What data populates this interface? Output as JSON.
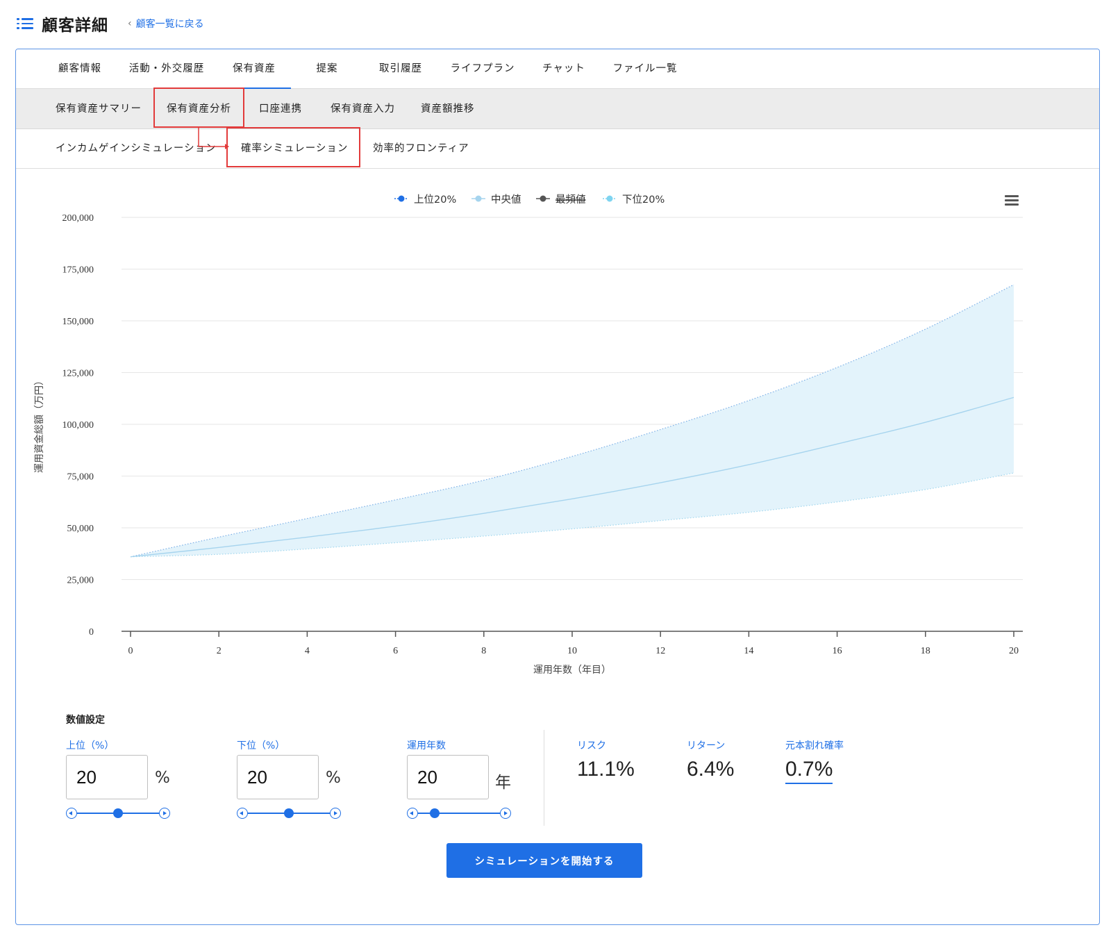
{
  "header": {
    "title": "顧客詳細",
    "back_link": "顧客一覧に戻る"
  },
  "tabs": [
    {
      "label": "顧客情報"
    },
    {
      "label": "活動・外交履歴"
    },
    {
      "label": "保有資産",
      "active": true
    },
    {
      "label": "提案"
    },
    {
      "label": "取引履歴"
    },
    {
      "label": "ライフプラン"
    },
    {
      "label": "チャット"
    },
    {
      "label": "ファイル一覧"
    }
  ],
  "subtabs": [
    {
      "label": "保有資産サマリー"
    },
    {
      "label": "保有資産分析",
      "highlighted": true
    },
    {
      "label": "口座連携"
    },
    {
      "label": "保有資産入力"
    },
    {
      "label": "資産額推移"
    }
  ],
  "subsubtabs": [
    {
      "label": "インカムゲインシミュレーション"
    },
    {
      "label": "確率シミュレーション",
      "highlighted": true
    },
    {
      "label": "効率的フロンティア"
    }
  ],
  "colors": {
    "accent": "#1f6fe5",
    "highlight_red": "#e23a3a",
    "band_fill": "#e3f3fb",
    "median_line": "#a6d4ee"
  },
  "chart_data": {
    "type": "area",
    "xlabel": "運用年数（年目）",
    "ylabel": "運用資金総額（万円）",
    "xlim": [
      0,
      20
    ],
    "ylim": [
      0,
      200000
    ],
    "x_ticks": [
      0,
      2,
      4,
      6,
      8,
      10,
      12,
      14,
      16,
      18,
      20
    ],
    "y_ticks": [
      0,
      25000,
      50000,
      75000,
      100000,
      125000,
      150000,
      175000,
      200000
    ],
    "y_tick_labels": [
      "0",
      "25,000",
      "50,000",
      "75,000",
      "100,000",
      "125,000",
      "150,000",
      "175,000",
      "200,000"
    ],
    "legend_position": "top-center",
    "x": [
      0,
      2,
      4,
      6,
      8,
      10,
      12,
      14,
      16,
      18,
      20
    ],
    "series": [
      {
        "name": "上位20%",
        "color": "#1f6fe5",
        "values": [
          36000,
          45500,
          54500,
          63500,
          73000,
          84500,
          97500,
          111500,
          127500,
          146000,
          167500
        ]
      },
      {
        "name": "中央値",
        "color": "#a6d4ee",
        "values": [
          36000,
          40500,
          45500,
          50800,
          57000,
          64000,
          71800,
          80500,
          90500,
          101000,
          113000
        ]
      },
      {
        "name": "最頻値",
        "color": "#555555",
        "values": []
      },
      {
        "name": "下位20%",
        "color": "#7fd4f0",
        "values": [
          36000,
          37200,
          39800,
          42800,
          46000,
          49500,
          53500,
          57500,
          62500,
          68500,
          76500
        ]
      }
    ]
  },
  "settings": {
    "title": "数値設定",
    "upper": {
      "label": "上位（%）",
      "value": "20",
      "unit": "%",
      "slider_fraction": 0.5
    },
    "lower": {
      "label": "下位（%）",
      "value": "20",
      "unit": "%",
      "slider_fraction": 0.5
    },
    "years": {
      "label": "運用年数",
      "value": "20",
      "unit": "年",
      "slider_fraction": 0.2
    }
  },
  "metrics": {
    "risk": {
      "label": "リスク",
      "value": "11.1%"
    },
    "return": {
      "label": "リターン",
      "value": "6.4%"
    },
    "loss_prob": {
      "label": "元本割れ確率",
      "value": "0.7%"
    }
  },
  "start_button": "シミュレーションを開始する"
}
